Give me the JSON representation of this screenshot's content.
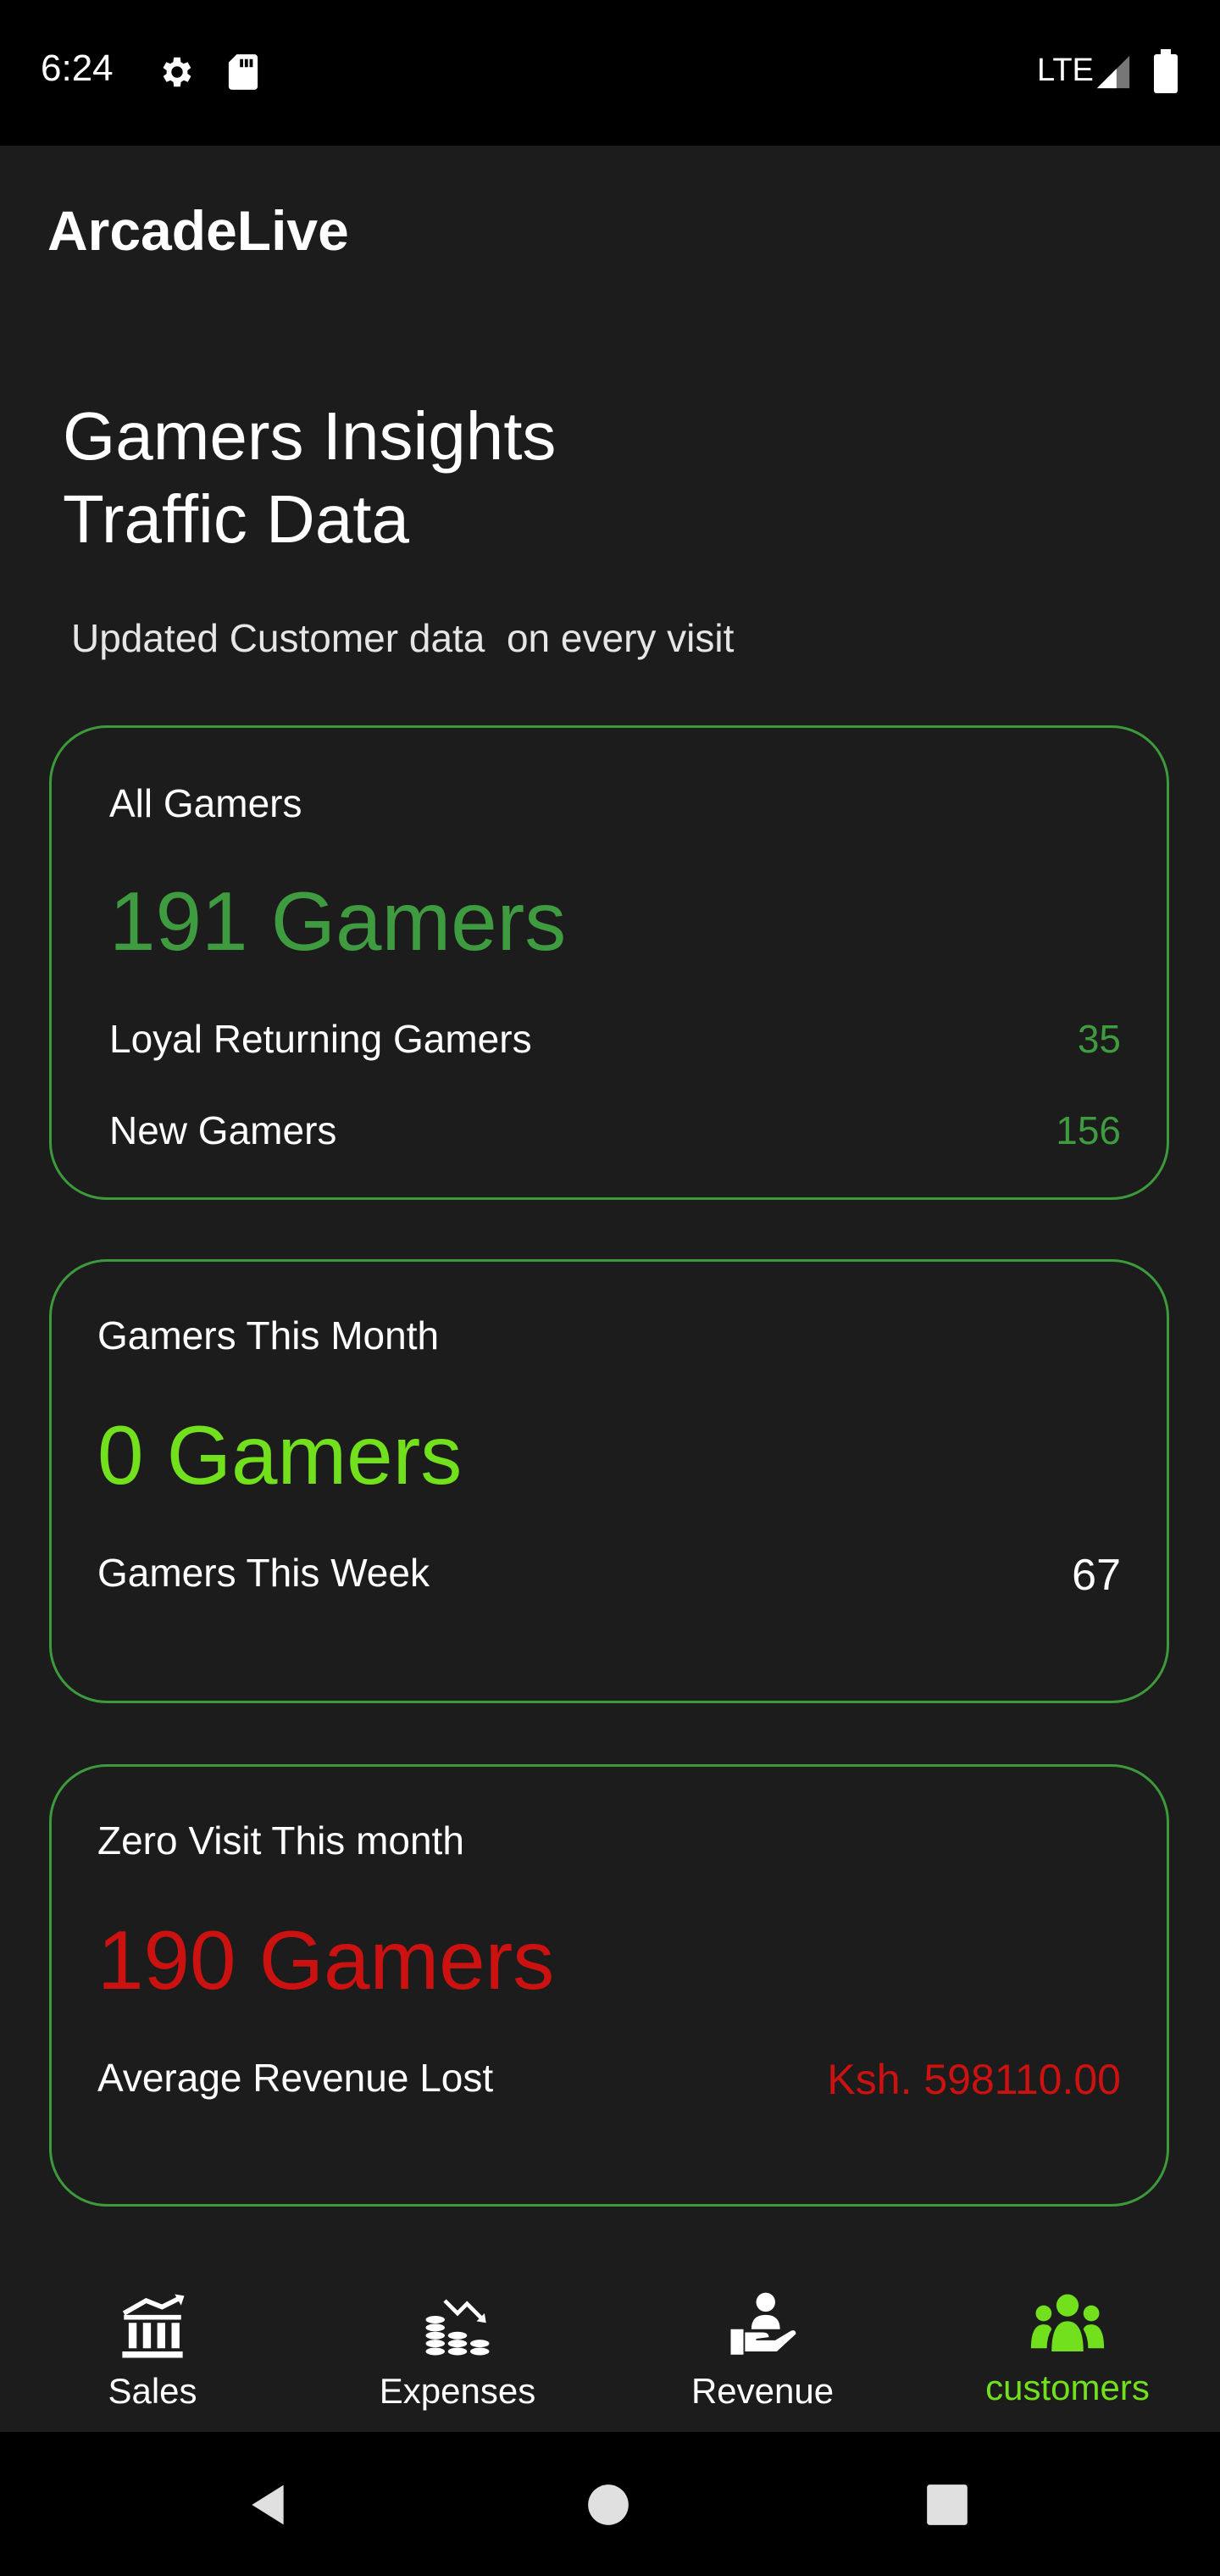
{
  "status_bar": {
    "time": "6:24",
    "network": "LTE"
  },
  "app_bar": {
    "title": "ArcadeLive"
  },
  "header": {
    "title_line1": "Gamers Insights",
    "title_line2": "Traffic Data",
    "subtitle": "Updated Customer data  on every visit"
  },
  "cards": {
    "all_gamers": {
      "label": "All Gamers",
      "total": "191 Gamers",
      "rows": [
        {
          "label": "Loyal Returning Gamers",
          "value": "35"
        },
        {
          "label": "New Gamers",
          "value": "156"
        }
      ]
    },
    "this_month": {
      "label": "Gamers This Month",
      "total": "0 Gamers",
      "rows": [
        {
          "label": "Gamers This Week",
          "value": "67"
        }
      ]
    },
    "zero_visit": {
      "label": "Zero Visit This month",
      "total": "190 Gamers",
      "rows": [
        {
          "label": "Average Revenue Lost",
          "value": "Ksh. 598110.00"
        }
      ]
    }
  },
  "bottom_nav": {
    "items": [
      {
        "label": "Sales",
        "icon": "bank-chart-icon",
        "active": false
      },
      {
        "label": "Expenses",
        "icon": "coins-down-icon",
        "active": false
      },
      {
        "label": "Revenue",
        "icon": "hand-holding-person-icon",
        "active": false
      },
      {
        "label": "customers",
        "icon": "group-icon",
        "active": true
      }
    ]
  },
  "colors": {
    "accent_active": "#72e01c",
    "card_border": "#3c9a3c",
    "positive": "#3f9b3f",
    "negative": "#cc1111",
    "background": "#1c1c1c"
  }
}
